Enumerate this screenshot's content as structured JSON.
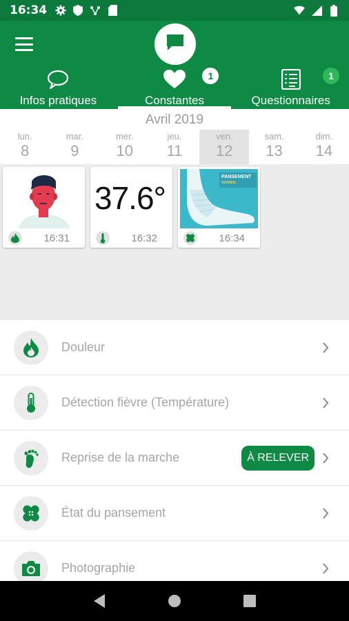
{
  "status_bar": {
    "time": "16:34",
    "left_icons": [
      "gear-icon",
      "shield-icon",
      "network-icon",
      "sim-icon"
    ],
    "right_icons": [
      "wifi-icon",
      "signal-icon",
      "battery-icon"
    ]
  },
  "header": {
    "menu_icon": "hamburger-icon",
    "center_icon": "chat-bubble-icon",
    "tabs": [
      {
        "label": "Infos pratiques",
        "icon": "speech-bubble-icon",
        "active": false,
        "badge": ""
      },
      {
        "label": "Constantes",
        "icon": "heart-icon",
        "active": true,
        "badge": "1"
      },
      {
        "label": "Questionnaires",
        "icon": "checklist-icon",
        "active": false,
        "badge": "1"
      }
    ]
  },
  "calendar": {
    "month": "Avril 2019",
    "days": [
      {
        "name": "lun.",
        "num": "8"
      },
      {
        "name": "mar.",
        "num": "9"
      },
      {
        "name": "mer.",
        "num": "10"
      },
      {
        "name": "jeu.",
        "num": "11"
      },
      {
        "name": "ven.",
        "num": "12",
        "selected": true
      },
      {
        "name": "sam.",
        "num": "13"
      },
      {
        "name": "dim.",
        "num": "14"
      }
    ]
  },
  "entries": [
    {
      "type": "douleur",
      "icon": "flame-icon",
      "time": "16:31"
    },
    {
      "type": "temperature",
      "value": "37.6°",
      "icon": "thermometer-icon",
      "time": "16:32"
    },
    {
      "type": "pansement",
      "image_text": "PANSEMENT",
      "image_subtext": "NORMAL",
      "icon": "bandage-icon",
      "time": "16:34"
    }
  ],
  "list": [
    {
      "label": "Douleur",
      "icon": "flame-icon"
    },
    {
      "label": "Détection fièvre (Température)",
      "icon": "thermometer-icon"
    },
    {
      "label": "Reprise de la marche",
      "icon": "footprint-icon",
      "action": "À RELEVER"
    },
    {
      "label": "État du pansement",
      "icon": "bandage-icon"
    },
    {
      "label": "Photographie",
      "icon": "camera-icon"
    }
  ],
  "colors": {
    "primary": "#0e8a45",
    "status_bar": "#0b7a3b",
    "badge_green": "#2eb85a"
  }
}
